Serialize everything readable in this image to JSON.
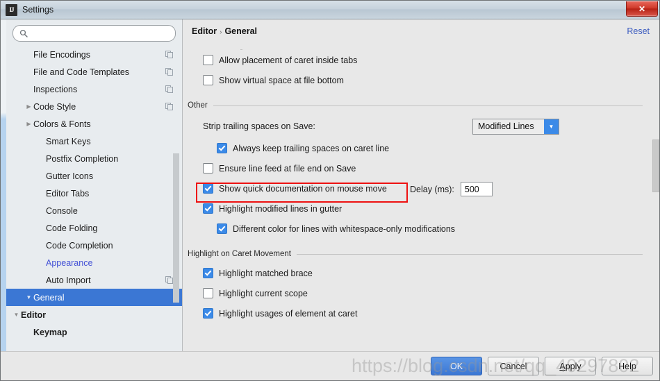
{
  "window": {
    "title": "Settings",
    "app_icon": "ij-logo-icon",
    "close_label": "✕"
  },
  "sidebar": {
    "search": {
      "value": "",
      "placeholder": ""
    },
    "items": [
      {
        "label": "Keymap",
        "indent": 1,
        "bold": true,
        "arrow": "",
        "selected": false,
        "modified": false,
        "copy": false
      },
      {
        "label": "Editor",
        "indent": 0,
        "bold": true,
        "arrow": "▼",
        "selected": false,
        "modified": false,
        "copy": false
      },
      {
        "label": "General",
        "indent": 1,
        "bold": false,
        "arrow": "▼",
        "selected": true,
        "modified": false,
        "copy": false
      },
      {
        "label": "Auto Import",
        "indent": 2,
        "bold": false,
        "arrow": "",
        "selected": false,
        "modified": false,
        "copy": true
      },
      {
        "label": "Appearance",
        "indent": 2,
        "bold": false,
        "arrow": "",
        "selected": false,
        "modified": true,
        "copy": false
      },
      {
        "label": "Code Completion",
        "indent": 2,
        "bold": false,
        "arrow": "",
        "selected": false,
        "modified": false,
        "copy": false
      },
      {
        "label": "Code Folding",
        "indent": 2,
        "bold": false,
        "arrow": "",
        "selected": false,
        "modified": false,
        "copy": false
      },
      {
        "label": "Console",
        "indent": 2,
        "bold": false,
        "arrow": "",
        "selected": false,
        "modified": false,
        "copy": false
      },
      {
        "label": "Editor Tabs",
        "indent": 2,
        "bold": false,
        "arrow": "",
        "selected": false,
        "modified": false,
        "copy": false
      },
      {
        "label": "Gutter Icons",
        "indent": 2,
        "bold": false,
        "arrow": "",
        "selected": false,
        "modified": false,
        "copy": false
      },
      {
        "label": "Postfix Completion",
        "indent": 2,
        "bold": false,
        "arrow": "",
        "selected": false,
        "modified": false,
        "copy": false
      },
      {
        "label": "Smart Keys",
        "indent": 2,
        "bold": false,
        "arrow": "",
        "selected": false,
        "modified": false,
        "copy": false
      },
      {
        "label": "Colors & Fonts",
        "indent": 1,
        "bold": false,
        "arrow": "▶",
        "selected": false,
        "modified": false,
        "copy": false
      },
      {
        "label": "Code Style",
        "indent": 1,
        "bold": false,
        "arrow": "▶",
        "selected": false,
        "modified": false,
        "copy": true
      },
      {
        "label": "Inspections",
        "indent": 1,
        "bold": false,
        "arrow": "",
        "selected": false,
        "modified": false,
        "copy": true
      },
      {
        "label": "File and Code Templates",
        "indent": 1,
        "bold": false,
        "arrow": "",
        "selected": false,
        "modified": false,
        "copy": true
      },
      {
        "label": "File Encodings",
        "indent": 1,
        "bold": false,
        "arrow": "",
        "selected": false,
        "modified": false,
        "copy": true
      }
    ]
  },
  "main": {
    "breadcrumb": {
      "parent": "Editor",
      "separator": "›",
      "current": "General"
    },
    "reset_label": "Reset",
    "top_options": [
      {
        "label": "Allow placement of caret inside tabs",
        "checked": false
      },
      {
        "label": "Show virtual space at file bottom",
        "checked": false
      }
    ],
    "other_section": {
      "title": "Other",
      "strip_label": "Strip trailing spaces on Save:",
      "strip_value": "Modified Lines",
      "options": [
        {
          "label": "Always keep trailing spaces on caret line",
          "checked": true,
          "indent": 2
        },
        {
          "label": "Ensure line feed at file end on Save",
          "checked": false,
          "indent": 1
        },
        {
          "label": "Show quick documentation on mouse move",
          "checked": true,
          "indent": 1,
          "highlighted": true
        },
        {
          "label": "Highlight modified lines in gutter",
          "checked": true,
          "indent": 1
        },
        {
          "label": "Different color for lines with whitespace-only modifications",
          "checked": true,
          "indent": 2
        }
      ],
      "delay_label": "Delay (ms):",
      "delay_value": "500"
    },
    "caret_section": {
      "title": "Highlight on Caret Movement",
      "options": [
        {
          "label": "Highlight matched brace",
          "checked": true
        },
        {
          "label": "Highlight current scope",
          "checked": false
        },
        {
          "label": "Highlight usages of element at caret",
          "checked": true
        }
      ]
    }
  },
  "footer": {
    "buttons": [
      {
        "label": "OK",
        "primary": true,
        "mnemonic": ""
      },
      {
        "label": "Cancel",
        "primary": false,
        "mnemonic": ""
      },
      {
        "label": "Apply",
        "primary": false,
        "mnemonic": "A"
      },
      {
        "label": "Help",
        "primary": false,
        "mnemonic": ""
      }
    ]
  },
  "watermark": {
    "text": "https://blog.csdn.net/qq_40297802"
  },
  "colors": {
    "accent": "#3b77d4",
    "checkbox_checked": "#3b8ae8",
    "modified_item": "#4452d6",
    "link": "#3b5bbf",
    "highlight_box": "#ee1111"
  }
}
